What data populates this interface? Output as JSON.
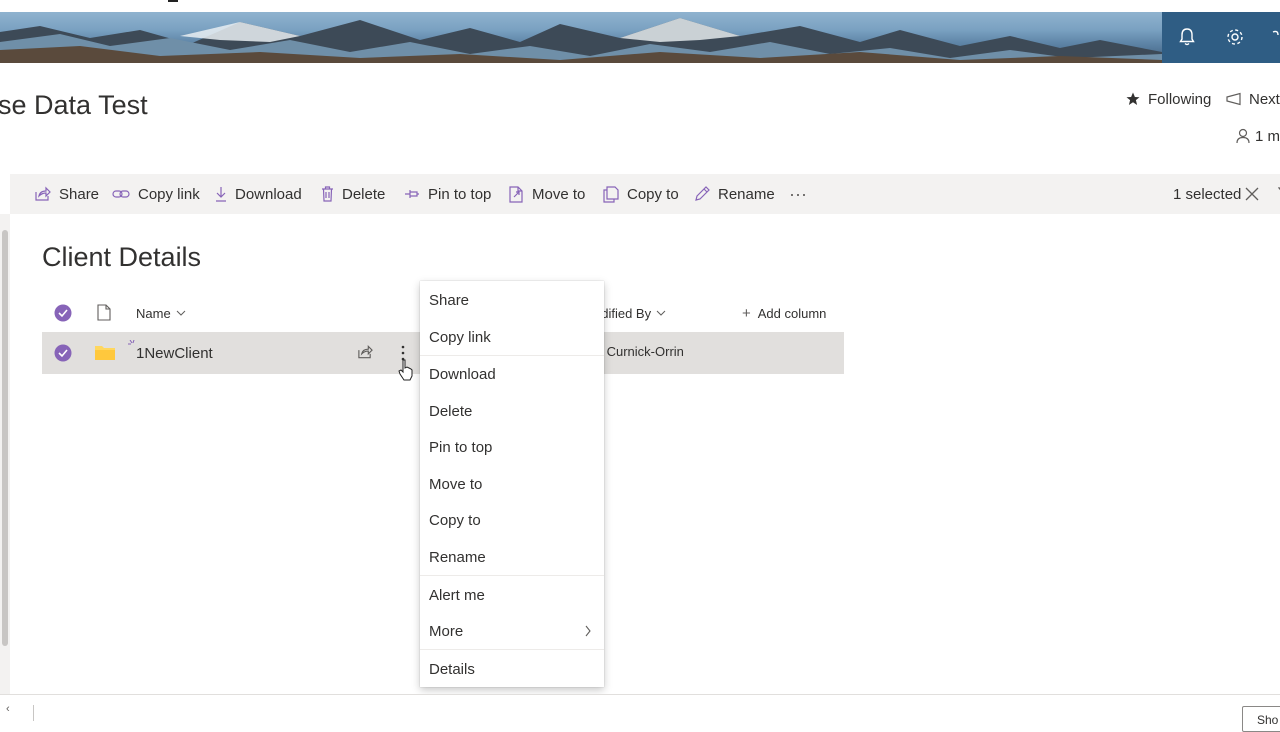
{
  "header": {
    "site_title": "se Data Test",
    "following_label": "Following",
    "next_label": "Next",
    "members_label": "1 m"
  },
  "command_bar": {
    "share": "Share",
    "copy_link": "Copy link",
    "download": "Download",
    "delete": "Delete",
    "pin_to_top": "Pin to top",
    "move_to": "Move to",
    "copy_to": "Copy to",
    "rename": "Rename",
    "more": "···",
    "selected_count": "1 selected"
  },
  "library": {
    "title": "Client Details",
    "columns": {
      "name": "Name",
      "modified_by": "odified By",
      "add_column": "Add column"
    },
    "rows": [
      {
        "name": "1NewClient",
        "modified_by": "ck Curnick-Orrin",
        "selected": true
      }
    ]
  },
  "context_menu": {
    "items": [
      {
        "label": "Share"
      },
      {
        "label": "Copy link"
      },
      {
        "label": "Download"
      },
      {
        "label": "Delete"
      },
      {
        "label": "Pin to top"
      },
      {
        "label": "Move to"
      },
      {
        "label": "Copy to"
      },
      {
        "label": "Rename"
      },
      {
        "label": "Alert me"
      },
      {
        "label": "More"
      },
      {
        "label": "Details"
      }
    ]
  },
  "bottom": {
    "left_text": "‹",
    "show_label": "Sho"
  },
  "colors": {
    "accent": "#8764b8",
    "folder": "#ffd75e",
    "command_bar_bg": "#f3f2f1",
    "selected_row_bg": "#e1dfdd"
  },
  "icons": [
    "bell-icon",
    "gear-icon",
    "star-icon",
    "next-icon",
    "person-icon",
    "share-icon",
    "link-icon",
    "download-icon",
    "delete-icon",
    "pin-icon",
    "move-icon",
    "copy-icon",
    "rename-icon",
    "close-icon",
    "filter-icon",
    "check-circle-icon",
    "file-icon",
    "folder-icon",
    "more-vertical-icon",
    "chevron-right-icon",
    "chevron-down-icon",
    "cursor-icon"
  ]
}
